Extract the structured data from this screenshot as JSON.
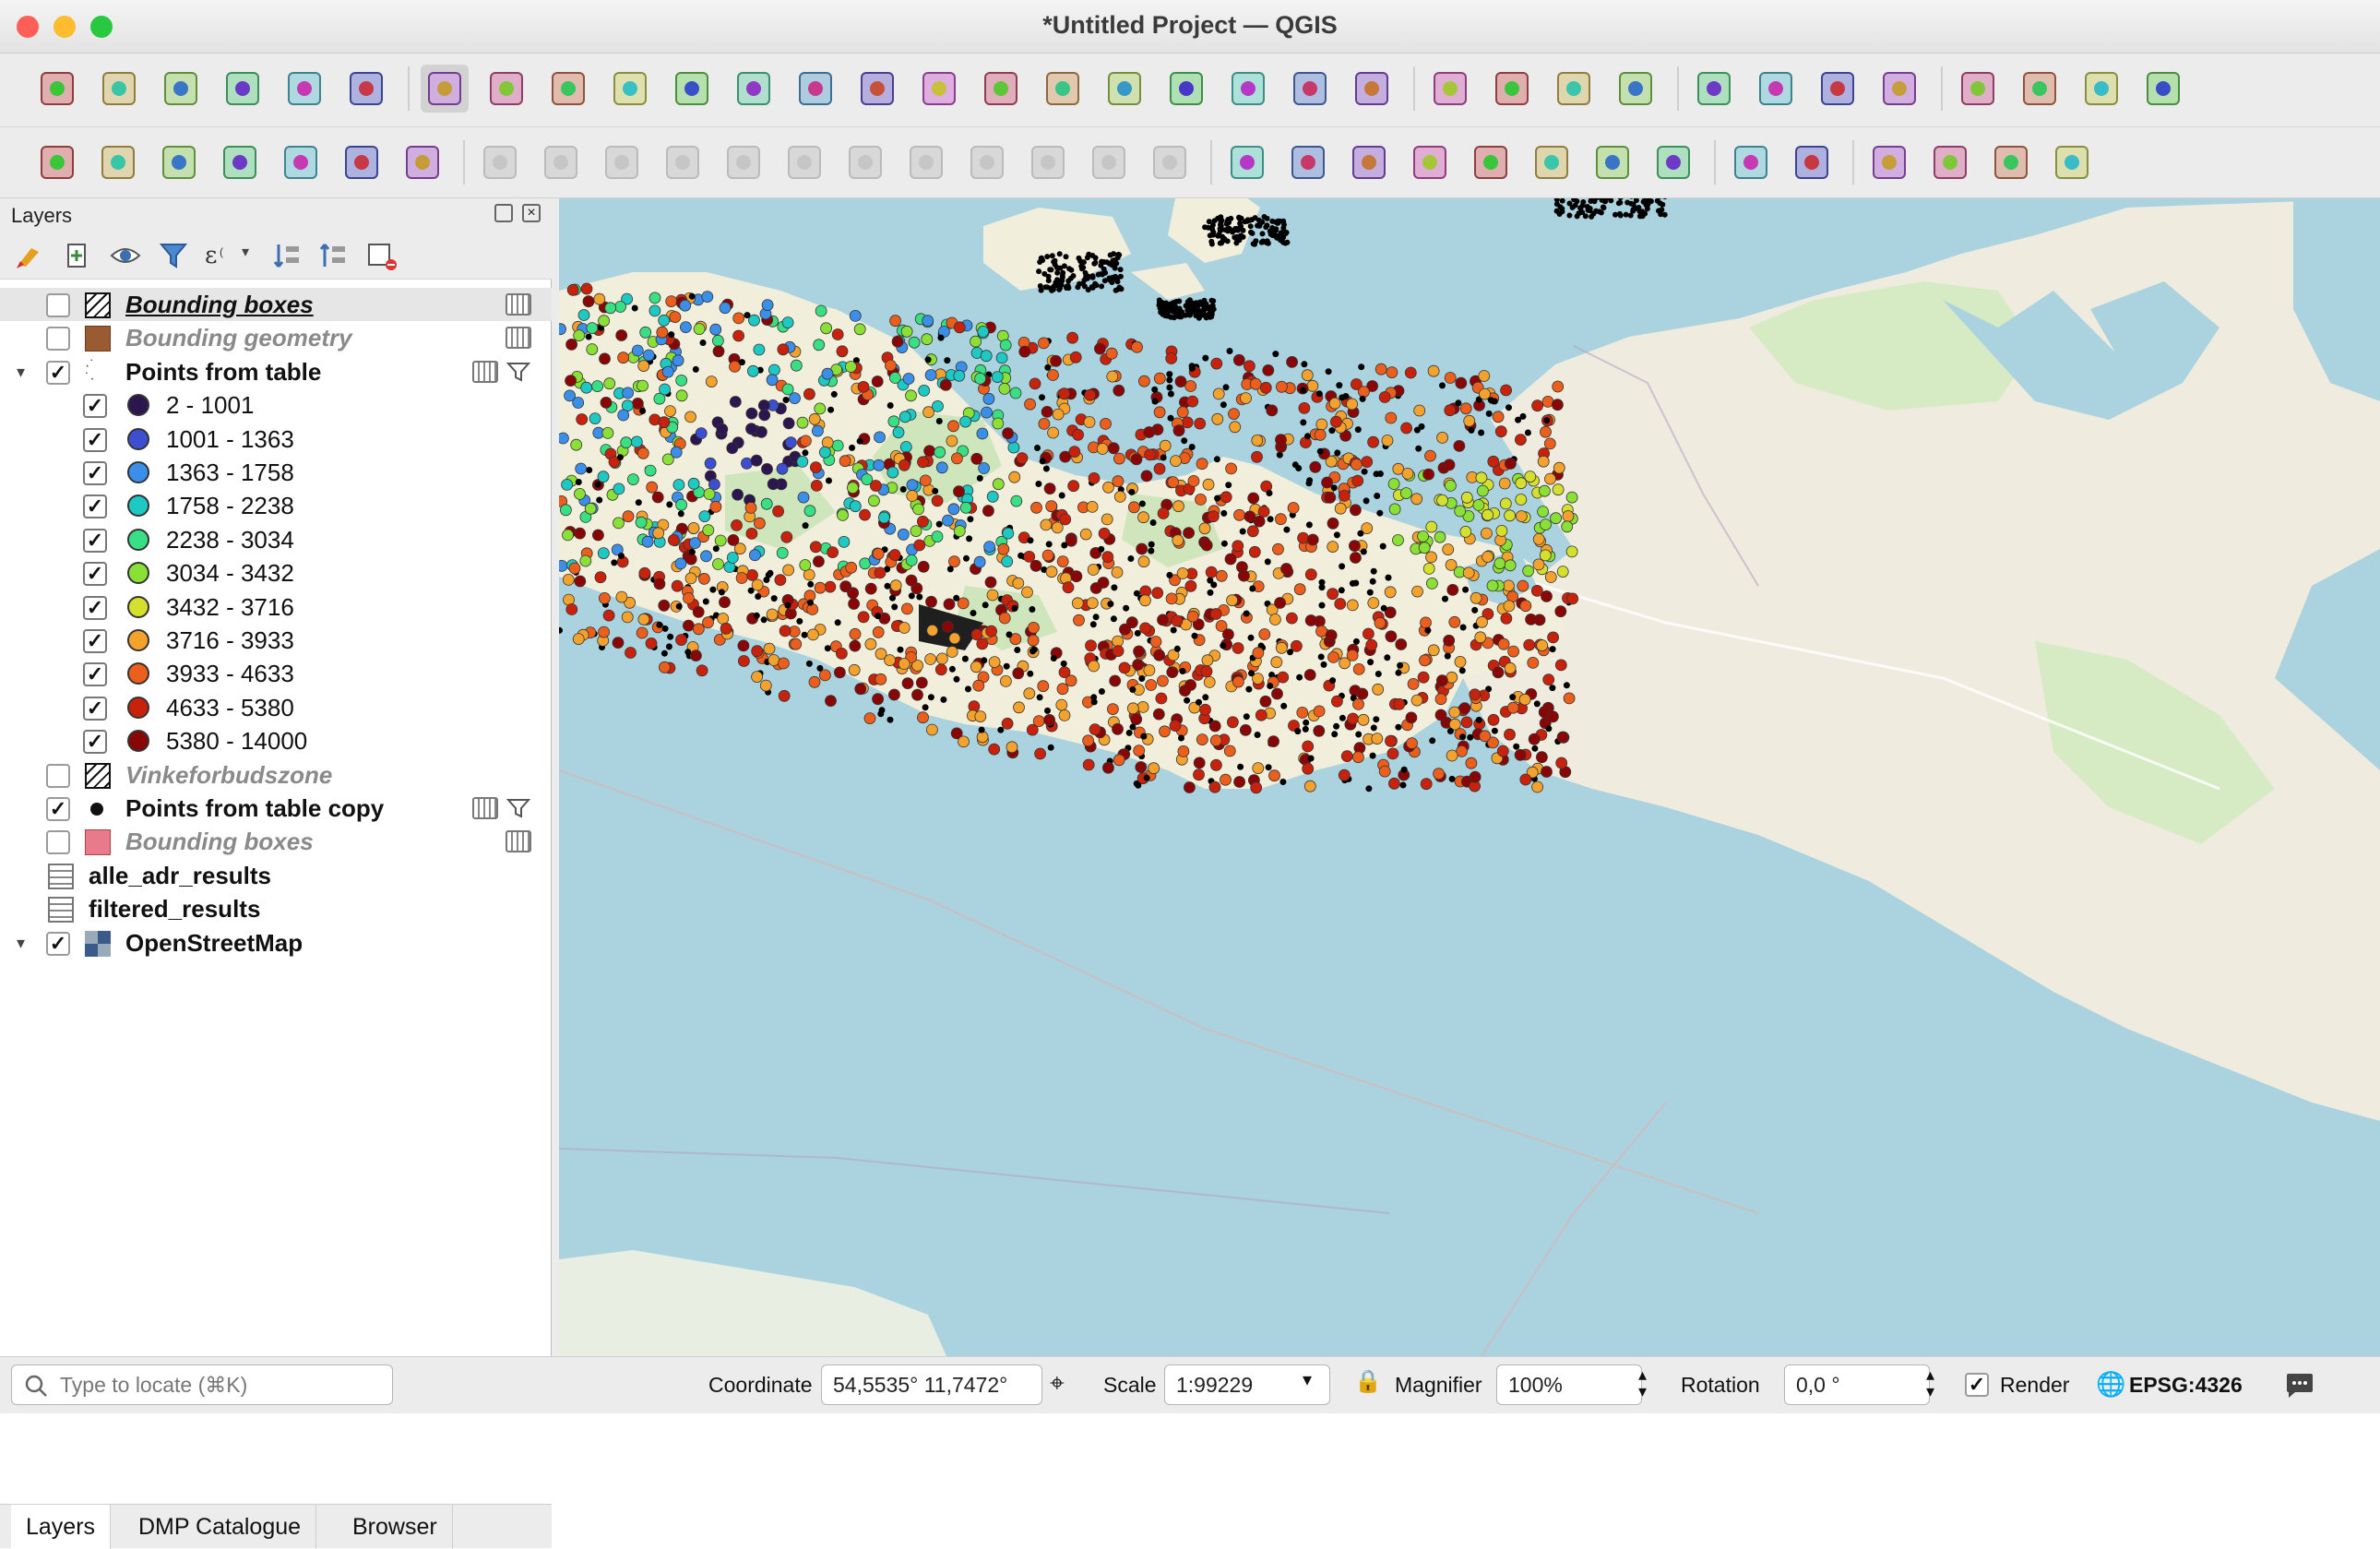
{
  "window": {
    "title": "*Untitled Project — QGIS"
  },
  "colors": {
    "close": "#ff5f57",
    "minimize": "#febc2e",
    "maximize": "#28c840",
    "accent": "#1a6fd6",
    "map_water": "#aad3df",
    "map_land": "#f2efe9",
    "map_green": "#c8e3b4"
  },
  "toolbar1": [
    "new-project-icon",
    "open-project-icon",
    "save-project-icon",
    "new-print-layout-icon",
    "layout-manager-icon",
    "style-manager-icon",
    "pan-icon",
    "pan-to-selection-icon",
    "zoom-in-icon",
    "zoom-out-icon",
    "zoom-full-icon",
    "zoom-selection-icon",
    "zoom-layer-icon",
    "zoom-native-icon",
    "zoom-last-icon",
    "zoom-next-icon",
    "new-map-view-icon",
    "new-3d-view-icon",
    "bookmark-icon",
    "show-bookmarks-icon",
    "temporal-controller-icon",
    "refresh-icon",
    "select-features-icon",
    "select-by-attribute-icon",
    "deselect-icon",
    "select-by-location-icon",
    "identify-icon",
    "attribute-table-icon",
    "processing-toolbox-icon",
    "statistics-icon",
    "open-table-icon",
    "measure-icon",
    "annotation-icon",
    "settings-icon"
  ],
  "toolbar2": [
    "add-layer-icon",
    "add-vector-icon",
    "digitize-icon",
    "add-raster-icon",
    "new-geopackage-icon",
    "mesh-icon",
    "virtual-layer-icon",
    "current-edits-icon",
    "toggle-editing-icon",
    "save-edits-icon",
    "add-feature-icon",
    "node-tool-icon",
    "vertex-tool-icon",
    "delete-icon",
    "cut-icon",
    "copy-icon",
    "paste-icon",
    "undo-icon",
    "redo-icon",
    "label-icon",
    "diagram-icon",
    "label-pin-icon",
    "label-highlight-icon",
    "label-show-icon",
    "label-move-icon",
    "label-rotate-icon",
    "label-change-icon",
    "label-toolbar-icon",
    "georef-icon",
    "plugin-globe-icon",
    "python-icon",
    "gps-icon",
    "help-icon"
  ],
  "layers_panel": {
    "title": "Layers"
  },
  "layers": [
    {
      "name": "Bounding boxes",
      "checked": false,
      "style": "underline-bold",
      "symbol": "hatch"
    },
    {
      "name": "Bounding geometry",
      "checked": false,
      "style": "grey-italic",
      "symbol": "brown-square"
    },
    {
      "name": "Points from table",
      "checked": true,
      "style": "bold",
      "symbol": "points"
    },
    {
      "name": "2 - 1001",
      "checked": true,
      "color": "#2b1650",
      "class": true
    },
    {
      "name": "1001 - 1363",
      "checked": true,
      "color": "#3b4fd0",
      "class": true
    },
    {
      "name": "1363 - 1758",
      "checked": true,
      "color": "#3c8fe8",
      "class": true
    },
    {
      "name": "1758 - 2238",
      "checked": true,
      "color": "#1ec9c4",
      "class": true
    },
    {
      "name": "2238 - 3034",
      "checked": true,
      "color": "#39e083",
      "class": true
    },
    {
      "name": "3034 - 3432",
      "checked": true,
      "color": "#8ae035",
      "class": true
    },
    {
      "name": "3432 - 3716",
      "checked": true,
      "color": "#d5df2d",
      "class": true
    },
    {
      "name": "3716 - 3933",
      "checked": true,
      "color": "#f3a22e",
      "class": true
    },
    {
      "name": "3933 - 4633",
      "checked": true,
      "color": "#ec5e1b",
      "class": true
    },
    {
      "name": "4633 - 5380",
      "checked": true,
      "color": "#c9220c",
      "class": true
    },
    {
      "name": "5380 - 14000",
      "checked": true,
      "color": "#8a0606",
      "class": true
    },
    {
      "name": "Vinkeforbudszone",
      "checked": false,
      "style": "grey-italic",
      "symbol": "hatch"
    },
    {
      "name": "Points from table copy",
      "checked": true,
      "style": "bold",
      "symbol": "black-dot"
    },
    {
      "name": "Bounding boxes",
      "checked": false,
      "style": "grey-italic",
      "symbol": "pink-square"
    },
    {
      "name": "alle_adr_results",
      "style": "bold",
      "symbol": "table"
    },
    {
      "name": "filtered_results",
      "style": "bold",
      "symbol": "table"
    },
    {
      "name": "OpenStreetMap",
      "checked": true,
      "style": "bold",
      "symbol": "raster"
    }
  ],
  "tabs": {
    "layers": "Layers",
    "dmp": "DMP Catalogue",
    "browser": "Browser"
  },
  "status": {
    "locate_placeholder": "Type to locate (⌘K)",
    "coordinate_label": "Coordinate",
    "coordinate": "54,5535°  11,7472°",
    "scale_label": "Scale",
    "scale": "1:99229",
    "magnifier_label": "Magnifier",
    "magnifier": "100%",
    "rotation_label": "Rotation",
    "rotation": "0,0 °",
    "render_label": "Render",
    "crs": "EPSG:4326"
  }
}
